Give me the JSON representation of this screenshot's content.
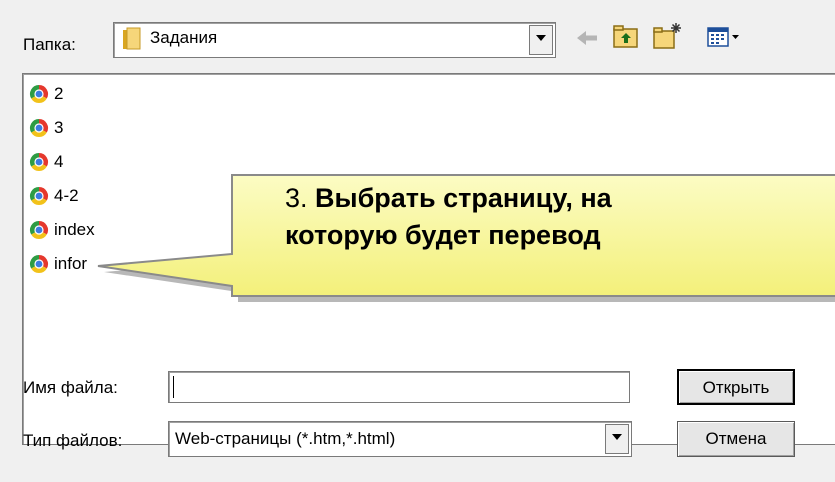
{
  "header": {
    "folder_label": "Папка:",
    "folder_value": "Задания",
    "toolbar": {
      "back_icon": "back-arrow-icon",
      "up_icon": "folder-up-icon",
      "new_folder_icon": "new-folder-icon",
      "view_menu_icon": "view-menu-icon"
    }
  },
  "files": [
    {
      "name": "2"
    },
    {
      "name": "3"
    },
    {
      "name": "4"
    },
    {
      "name": "4-2"
    },
    {
      "name": "index"
    },
    {
      "name": "infor"
    }
  ],
  "callout": {
    "number": "3.",
    "line1": "Выбрать страницу, на",
    "line2": "которую будет перевод",
    "fill": "#fafa96",
    "border": "#8a8a8a"
  },
  "bottom": {
    "filename_label": "Имя файла:",
    "filename_value": "",
    "filetype_label": "Тип файлов:",
    "filetype_value": "Web-страницы (*.htm,*.html)",
    "open_button": "Открыть",
    "cancel_button": "Отмена"
  },
  "colors": {
    "window_bg": "#f0f0f0",
    "field_bg": "#ffffff",
    "field_border": "#7a7a7a"
  }
}
